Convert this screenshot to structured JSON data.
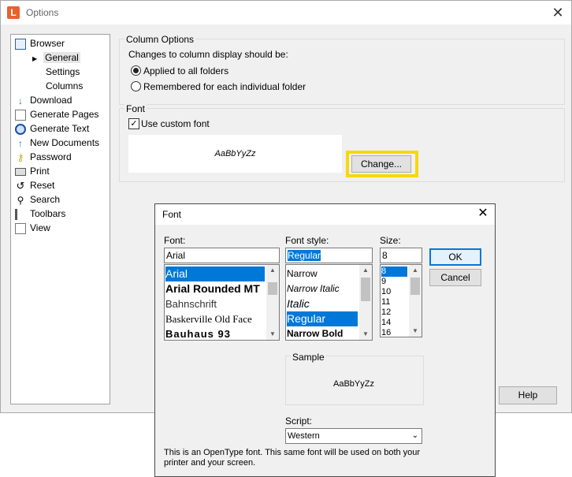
{
  "options": {
    "title": "Options",
    "tree": [
      {
        "label": "Browser",
        "icon": "browser-icon"
      },
      {
        "label": "General",
        "icon": "chevron-right-icon"
      },
      {
        "label": "Settings",
        "icon": ""
      },
      {
        "label": "Columns",
        "icon": ""
      },
      {
        "label": "Download",
        "icon": "download-icon"
      },
      {
        "label": "Generate Pages",
        "icon": "generate-pages-icon"
      },
      {
        "label": "Generate Text",
        "icon": "generate-text-icon"
      },
      {
        "label": "New Documents",
        "icon": "new-documents-icon"
      },
      {
        "label": "Password",
        "icon": "key-icon"
      },
      {
        "label": "Print",
        "icon": "printer-icon"
      },
      {
        "label": "Reset",
        "icon": "reset-icon"
      },
      {
        "label": "Search",
        "icon": "search-icon"
      },
      {
        "label": "Toolbars",
        "icon": "toolbars-icon"
      },
      {
        "label": "View",
        "icon": "view-icon"
      }
    ],
    "column_options": {
      "group_label": "Column Options",
      "prompt": "Changes to column display should be:",
      "radio_all": "Applied to all folders",
      "radio_each": "Remembered for each individual folder"
    },
    "font_group": {
      "group_label": "Font",
      "checkbox_label": "Use custom font",
      "preview_text": "AaBbYyZz",
      "change_button": "Change..."
    },
    "help_button": "Help"
  },
  "font_dialog": {
    "title": "Font",
    "font_label": "Font:",
    "font_value": "Arial",
    "fonts": [
      "Arial",
      "Arial Rounded MT",
      "Bahnschrift",
      "Baskerville Old Face",
      "Bauhaus 93"
    ],
    "style_label": "Font style:",
    "style_value": "Regular",
    "styles": [
      "Narrow",
      "Narrow Italic",
      "Italic",
      "Regular",
      "Narrow Bold"
    ],
    "size_label": "Size:",
    "size_value": "8",
    "sizes": [
      "8",
      "9",
      "10",
      "11",
      "12",
      "14",
      "16"
    ],
    "ok": "OK",
    "cancel": "Cancel",
    "sample_label": "Sample",
    "sample_text": "AaBbYyZz",
    "script_label": "Script:",
    "script_value": "Western",
    "info": "This is an OpenType font. This same font will be used on both your printer and your screen."
  },
  "colors": {
    "highlight": "#f5d90a",
    "selection": "#0078d7",
    "app_icon": "#e8622c",
    "dialog_border": "#4a4a4a"
  }
}
